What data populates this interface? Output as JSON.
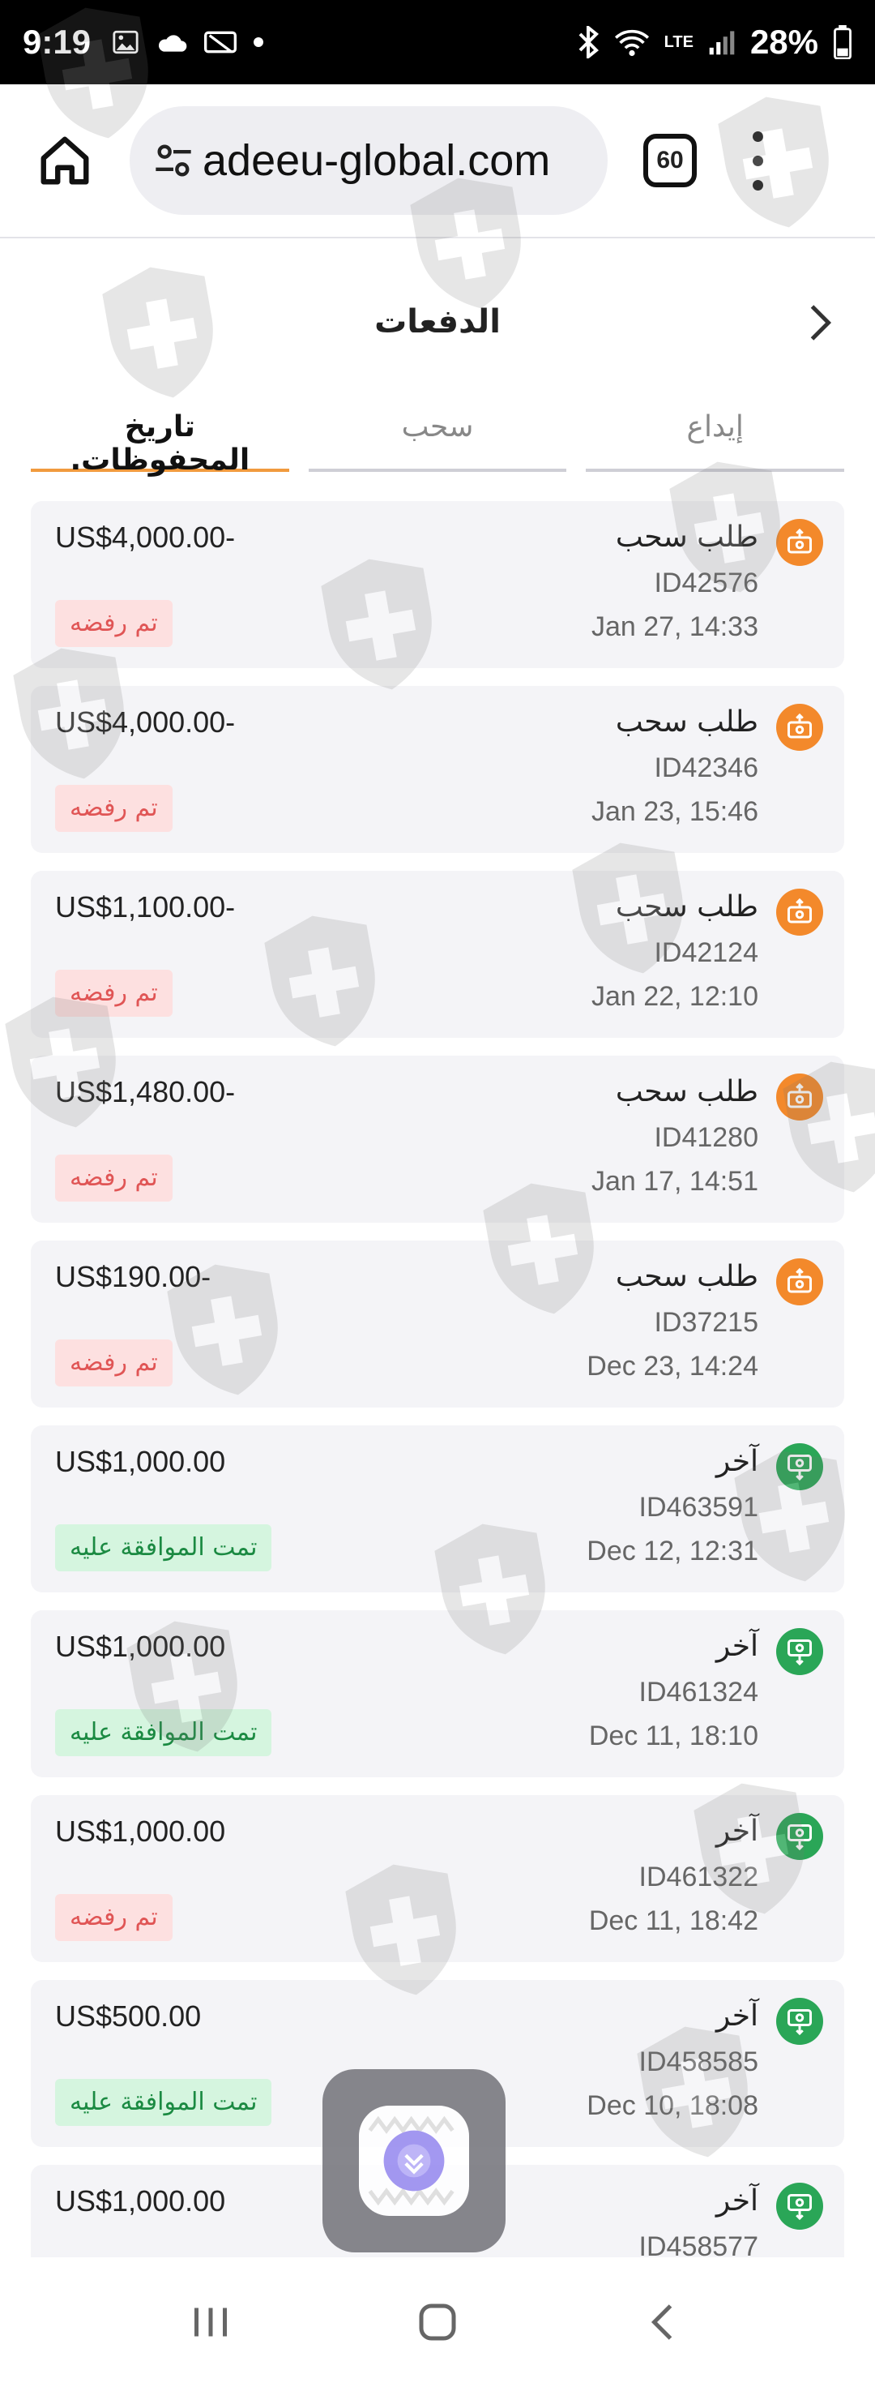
{
  "status_bar": {
    "time": "9:19",
    "battery": "28%",
    "network": "LTE"
  },
  "browser": {
    "url": "adeeu-global.com",
    "tab_count": "60"
  },
  "page": {
    "title": "الدفعات"
  },
  "tabs": [
    {
      "label": "إيداع",
      "active": false
    },
    {
      "label": "سحب",
      "active": false
    },
    {
      "label": "تاريخ المحفوظات.",
      "active": true
    }
  ],
  "transactions": [
    {
      "type": "طلب سحب",
      "kind": "withdraw",
      "id": "ID42576",
      "date": "Jan 27, 14:33",
      "amount": "US$4,000.00-",
      "status": "تم رفضه",
      "status_kind": "rejected"
    },
    {
      "type": "طلب سحب",
      "kind": "withdraw",
      "id": "ID42346",
      "date": "Jan 23, 15:46",
      "amount": "US$4,000.00-",
      "status": "تم رفضه",
      "status_kind": "rejected"
    },
    {
      "type": "طلب سحب",
      "kind": "withdraw",
      "id": "ID42124",
      "date": "Jan 22, 12:10",
      "amount": "US$1,100.00-",
      "status": "تم رفضه",
      "status_kind": "rejected"
    },
    {
      "type": "طلب سحب",
      "kind": "withdraw",
      "id": "ID41280",
      "date": "Jan 17, 14:51",
      "amount": "US$1,480.00-",
      "status": "تم رفضه",
      "status_kind": "rejected"
    },
    {
      "type": "طلب سحب",
      "kind": "withdraw",
      "id": "ID37215",
      "date": "Dec 23, 14:24",
      "amount": "US$190.00-",
      "status": "تم رفضه",
      "status_kind": "rejected"
    },
    {
      "type": "آخر",
      "kind": "deposit",
      "id": "ID463591",
      "date": "Dec 12, 12:31",
      "amount": "US$1,000.00",
      "status": "تمت الموافقة عليه",
      "status_kind": "approved"
    },
    {
      "type": "آخر",
      "kind": "deposit",
      "id": "ID461324",
      "date": "Dec 11, 18:10",
      "amount": "US$1,000.00",
      "status": "تمت الموافقة عليه",
      "status_kind": "approved"
    },
    {
      "type": "آخر",
      "kind": "deposit",
      "id": "ID461322",
      "date": "Dec 11, 18:42",
      "amount": "US$1,000.00",
      "status": "تم رفضه",
      "status_kind": "rejected"
    },
    {
      "type": "آخر",
      "kind": "deposit",
      "id": "ID458585",
      "date": "Dec 10, 18:08",
      "amount": "US$500.00",
      "status": "تمت الموافقة عليه",
      "status_kind": "approved"
    },
    {
      "type": "آخر",
      "kind": "deposit",
      "id": "ID458577",
      "date": "",
      "amount": "US$1,000.00",
      "status": "",
      "status_kind": ""
    }
  ],
  "colors": {
    "active_tab_underline": "#f19a3e",
    "withdraw_icon": "#f3892b",
    "deposit_icon": "#2aa657",
    "rejected_bg": "#fde0e0",
    "rejected_text": "#e05555",
    "approved_bg": "#d5f5df",
    "approved_text": "#1b8a42"
  },
  "icons": {
    "withdraw": "cash-up-icon",
    "deposit": "cash-down-icon",
    "back": "chevron-right-icon",
    "home": "home-icon",
    "menu": "more-vert-icon"
  }
}
